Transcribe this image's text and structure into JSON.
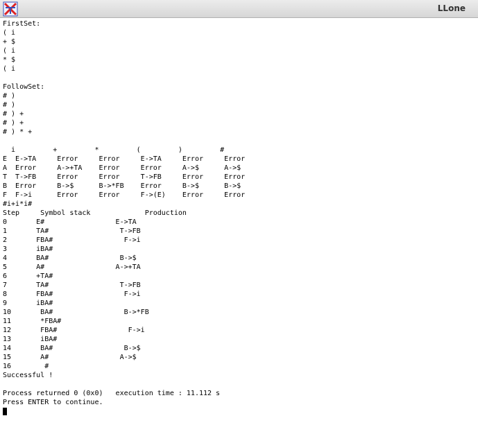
{
  "window": {
    "title": "LLone",
    "icon": "x-terminal-icon"
  },
  "terminal": {
    "lines": [
      "FirstSet:",
      "( i",
      "+ $",
      "( i",
      "* $",
      "( i",
      "",
      "FollowSet:",
      "# )",
      "# )",
      "# ) +",
      "# ) +",
      "# ) * +",
      "",
      "  i         +         *         (         )         #",
      "E  E->TA     Error     Error     E->TA     Error     Error",
      "A  Error     A->+TA    Error     Error     A->$      A->$",
      "T  T->FB     Error     Error     T->FB     Error     Error",
      "B  Error     B->$      B->*FB    Error     B->$      B->$",
      "F  F->i      Error     Error     F->(E)    Error     Error",
      "#i+i*i#",
      "Step     Symbol stack             Production",
      "0       E#                 E->TA",
      "1       TA#                 T->FB",
      "2       FBA#                 F->i",
      "3       iBA#",
      "4       BA#                 B->$",
      "5       A#                 A->+TA",
      "6       +TA#",
      "7       TA#                 T->FB",
      "8       FBA#                 F->i",
      "9       iBA#",
      "10       BA#                 B->*FB",
      "11       *FBA#",
      "12       FBA#                 F->i",
      "13       iBA#",
      "14       BA#                 B->$",
      "15       A#                 A->$",
      "16        #",
      "Successful !",
      "",
      "Process returned 0 (0x0)   execution time : 11.112 s",
      "Press ENTER to continue."
    ]
  }
}
